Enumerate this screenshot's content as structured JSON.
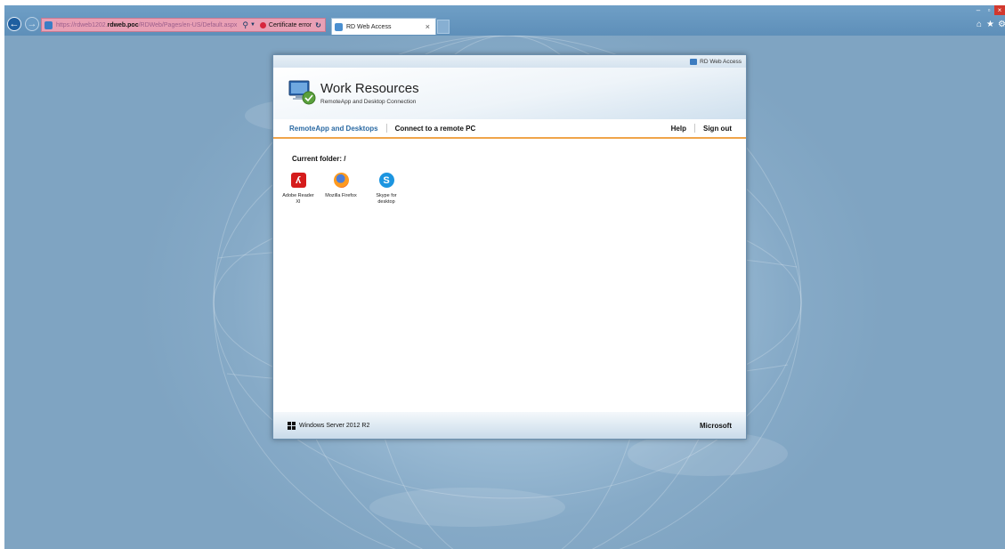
{
  "browser": {
    "url_prefix": "https://rdweb1202.",
    "url_host": "rdweb.poc",
    "url_suffix": "/RDWeb/Pages/en-US/Default.aspx",
    "certificate_error": "Certificate error",
    "tab_title": "RD Web Access",
    "tab_close": "×"
  },
  "panel": {
    "top_label": "RD Web Access",
    "title": "Work Resources",
    "subtitle": "RemoteApp and Desktop Connection",
    "nav": {
      "remoteapp": "RemoteApp and Desktops",
      "connect": "Connect to a remote PC",
      "help": "Help",
      "signout": "Sign out"
    },
    "current_folder": "Current folder: /",
    "apps": [
      {
        "label": "Adobe Reader XI",
        "icon": "adobe-pdf-icon"
      },
      {
        "label": "Mozilla Firefox",
        "icon": "firefox-icon"
      },
      {
        "label": "Skype for desktop",
        "icon": "skype-icon"
      }
    ],
    "footer_os": "Windows Server 2012 R2",
    "footer_brand": "Microsoft"
  },
  "colors": {
    "accent": "#2b6aa3",
    "nav_underline": "#f0a54a",
    "address_error": "#e9a0b5"
  }
}
